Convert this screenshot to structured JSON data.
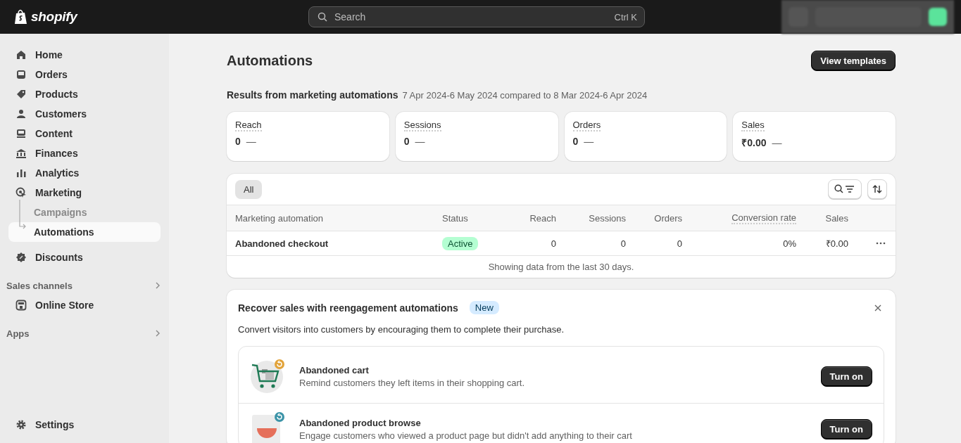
{
  "topbar": {
    "brand": "shopify",
    "search": {
      "placeholder": "Search",
      "shortcut": "Ctrl K"
    }
  },
  "sidebar": {
    "items": [
      {
        "label": "Home",
        "selected": false
      },
      {
        "label": "Orders",
        "selected": false
      },
      {
        "label": "Products",
        "selected": false
      },
      {
        "label": "Customers",
        "selected": false
      },
      {
        "label": "Content",
        "selected": false
      },
      {
        "label": "Finances",
        "selected": false
      },
      {
        "label": "Analytics",
        "selected": false
      },
      {
        "label": "Marketing",
        "selected": false,
        "expanded": true,
        "children": [
          {
            "label": "Campaigns",
            "selected": false
          },
          {
            "label": "Automations",
            "selected": true
          }
        ]
      },
      {
        "label": "Discounts",
        "selected": false
      }
    ],
    "sections": [
      {
        "title": "Sales channels",
        "items": [
          {
            "label": "Online Store",
            "selected": false
          }
        ]
      },
      {
        "title": "Apps"
      }
    ],
    "settings": "Settings"
  },
  "page": {
    "title": "Automations",
    "action": "View templates",
    "results": {
      "title": "Results from marketing automations",
      "period": "7 Apr 2024-6 May 2024 compared to 8 Mar 2024-6 Apr 2024"
    },
    "metrics": [
      {
        "label": "Reach",
        "value": "0",
        "change": "—"
      },
      {
        "label": "Sessions",
        "value": "0",
        "change": "—"
      },
      {
        "label": "Orders",
        "value": "0",
        "change": "—"
      },
      {
        "label": "Sales",
        "value": "₹0.00",
        "change": "—"
      }
    ],
    "table": {
      "tabs": [
        {
          "label": "All",
          "selected": true
        }
      ],
      "columns": [
        "Marketing automation",
        "Status",
        "Reach",
        "Sessions",
        "Orders",
        "Conversion rate",
        "Sales"
      ],
      "rows": [
        {
          "name": "Abandoned checkout",
          "status": "Active",
          "reach": "0",
          "sessions": "0",
          "orders": "0",
          "conversion_rate": "0%",
          "sales": "₹0.00"
        }
      ],
      "footer": "Showing data from the last 30 days."
    },
    "banner": {
      "title": "Recover sales with reengagement automations",
      "badge": "New",
      "description": "Convert visitors into customers by encouraging them to complete their purchase.",
      "items": [
        {
          "title": "Abandoned cart",
          "description": "Remind customers they left items in their shopping cart.",
          "button": "Turn on"
        },
        {
          "title": "Abandoned product browse",
          "description": "Engage customers who viewed a product page but didn't add anything to their cart",
          "button": "Turn on"
        }
      ]
    }
  }
}
